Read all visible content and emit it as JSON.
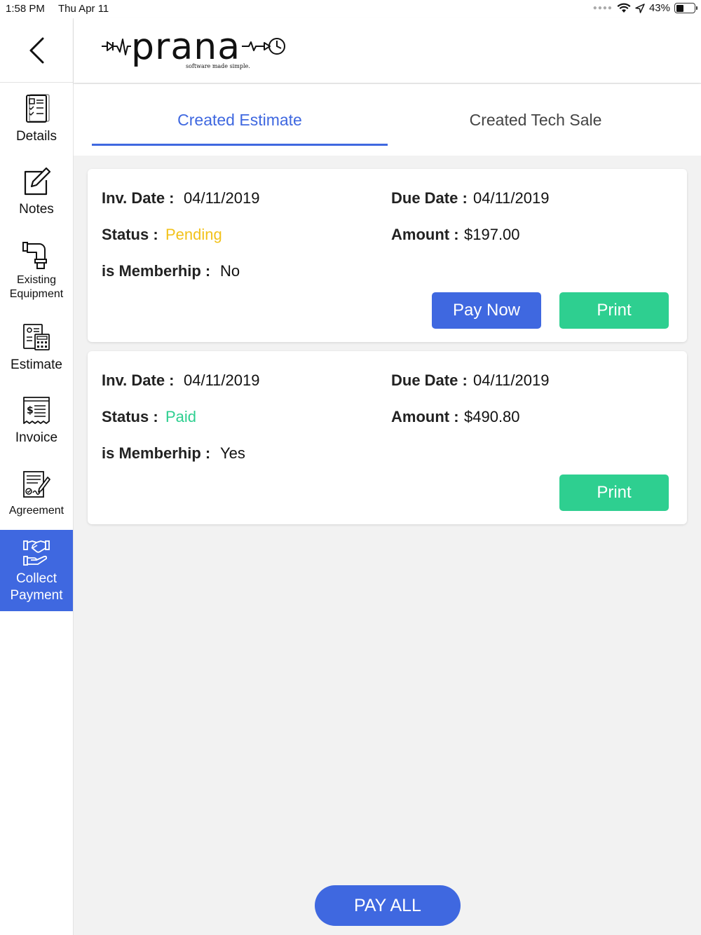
{
  "status_bar": {
    "time": "1:58 PM",
    "date": "Thu Apr 11",
    "battery": "43%"
  },
  "brand": {
    "name": "prana",
    "tagline": "software made simple."
  },
  "sidebar": {
    "items": [
      {
        "label": "Details"
      },
      {
        "label": "Notes"
      },
      {
        "label": "Existing Equipment"
      },
      {
        "label": "Estimate"
      },
      {
        "label": "Invoice"
      },
      {
        "label": "Agreement"
      },
      {
        "label": "Collect Payment"
      }
    ]
  },
  "tabs": [
    {
      "label": "Created Estimate",
      "active": true
    },
    {
      "label": "Created Tech Sale",
      "active": false
    }
  ],
  "labels": {
    "inv_date": "Inv. Date :",
    "due_date": "Due Date :",
    "status": "Status :",
    "amount": "Amount :",
    "membership": "is Memberhip :",
    "pay_now": "Pay Now",
    "print": "Print",
    "pay_all": "PAY ALL"
  },
  "cards": [
    {
      "inv_date": "04/11/2019",
      "due_date": "04/11/2019",
      "status": "Pending",
      "status_color": "#f2c21b",
      "amount": "$197.00",
      "membership": "No"
    },
    {
      "inv_date": "04/11/2019",
      "due_date": "04/11/2019",
      "status": "Paid",
      "status_color": "#2ecf90",
      "amount": "$490.80",
      "membership": "Yes"
    }
  ],
  "colors": {
    "accent": "#3f68e0",
    "print": "#2ecf90",
    "pending": "#f2c21b",
    "paid": "#2ecf90"
  }
}
